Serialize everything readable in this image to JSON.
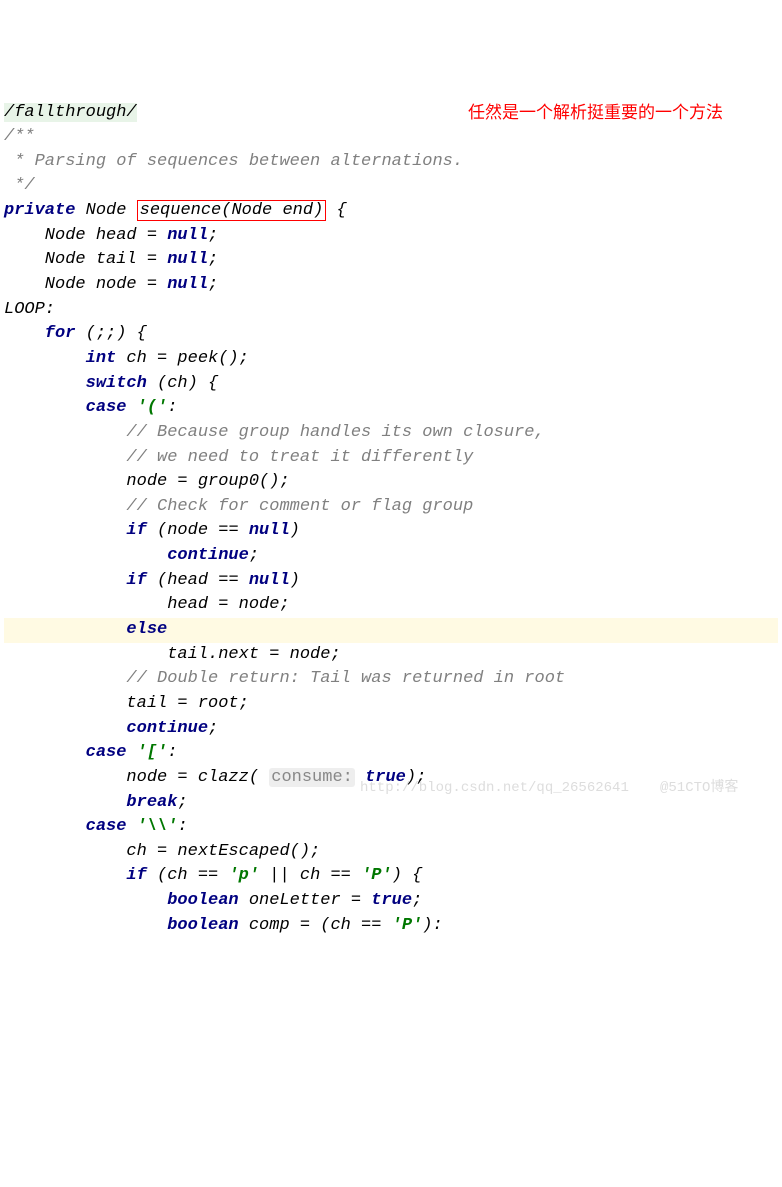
{
  "code": {
    "line1": "/fallthrough/",
    "line2": "/**",
    "line3": " * Parsing of sequences between alternations.",
    "line4": " */",
    "line5_private": "private",
    "line5_node": " Node ",
    "line5_method": "sequence(Node end)",
    "line5_brace": " {",
    "line6_pre": "    Node head = ",
    "line6_null": "null",
    "line6_post": ";",
    "line7_pre": "    Node tail = ",
    "line7_null": "null",
    "line7_post": ";",
    "line8_pre": "    Node node = ",
    "line8_null": "null",
    "line8_post": ";",
    "line9": "LOOP:",
    "line10_for": "    for",
    "line10_rest": " (;;) {",
    "line11_int": "        int",
    "line11_rest": " ch = peek();",
    "line12_switch": "        switch",
    "line12_rest": " (ch) {",
    "line13_case": "        case",
    "line13_char": " '('",
    "line13_colon": ":",
    "line14": "            // Because group handles its own closure,",
    "line15": "            // we need to treat it differently",
    "line16": "            node = group0();",
    "line17": "            // Check for comment or flag group",
    "line18_if": "            if",
    "line18_mid": " (node == ",
    "line18_null": "null",
    "line18_paren": ")",
    "line19_continue": "                continue",
    "line19_semi": ";",
    "line20_if": "            if",
    "line20_mid": " (head == ",
    "line20_null": "null",
    "line20_paren": ")",
    "line21": "                head = node;",
    "line22_else": "            else",
    "line23": "                tail.next = node;",
    "line24": "            // Double return: Tail was returned in root",
    "line25": "            tail = root;",
    "line26_continue": "            continue",
    "line26_semi": ";",
    "line27_case": "        case",
    "line27_char": " '['",
    "line27_colon": ":",
    "line28_pre": "            node = clazz( ",
    "line28_hint": "consume:",
    "line28_true": " true",
    "line28_post": ");",
    "line29_break": "            break",
    "line29_semi": ";",
    "line30_case": "        case",
    "line30_char": " '\\\\'",
    "line30_colon": ":",
    "line31": "            ch = nextEscaped();",
    "line32_if": "            if",
    "line32_mid1": " (ch == ",
    "line32_p": "'p'",
    "line32_or": " || ch == ",
    "line32_P": "'P'",
    "line32_end": ") {",
    "line33_boolean": "                boolean",
    "line33_mid": " oneLetter = ",
    "line33_true": "true",
    "line33_semi": ";",
    "line34_boolean": "                boolean",
    "line34_mid": " comp = (ch == ",
    "line34_P": "'P'",
    "line34_end": "):"
  },
  "annotation": {
    "text": "任然是一个解析挺重要的一个方法"
  },
  "watermark1": "http://blog.csdn.net/qq_26562641",
  "watermark2": "@51CTO博客"
}
